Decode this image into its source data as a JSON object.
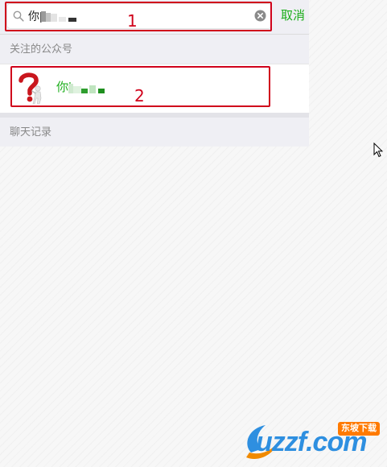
{
  "search": {
    "query": "你|",
    "cancel_label": "取消"
  },
  "sections": {
    "official_accounts_label": "关注的公众号",
    "chat_history_label": "聊天记录"
  },
  "results": [
    {
      "name": "你|"
    }
  ],
  "annotations": {
    "label_1": "1",
    "label_2": "2"
  },
  "watermark": {
    "brand_text": "uzzf.com",
    "badge_text": "东坡下载"
  },
  "colors": {
    "accent_green": "#1aad19",
    "annotation_red": "#d0021b",
    "watermark_blue": "#2e8fe0",
    "watermark_orange": "#ff7a00"
  },
  "icons": {
    "search": "search-icon",
    "clear": "clear-icon",
    "avatar": "question-mark-person-icon",
    "cursor": "mouse-pointer-icon"
  }
}
